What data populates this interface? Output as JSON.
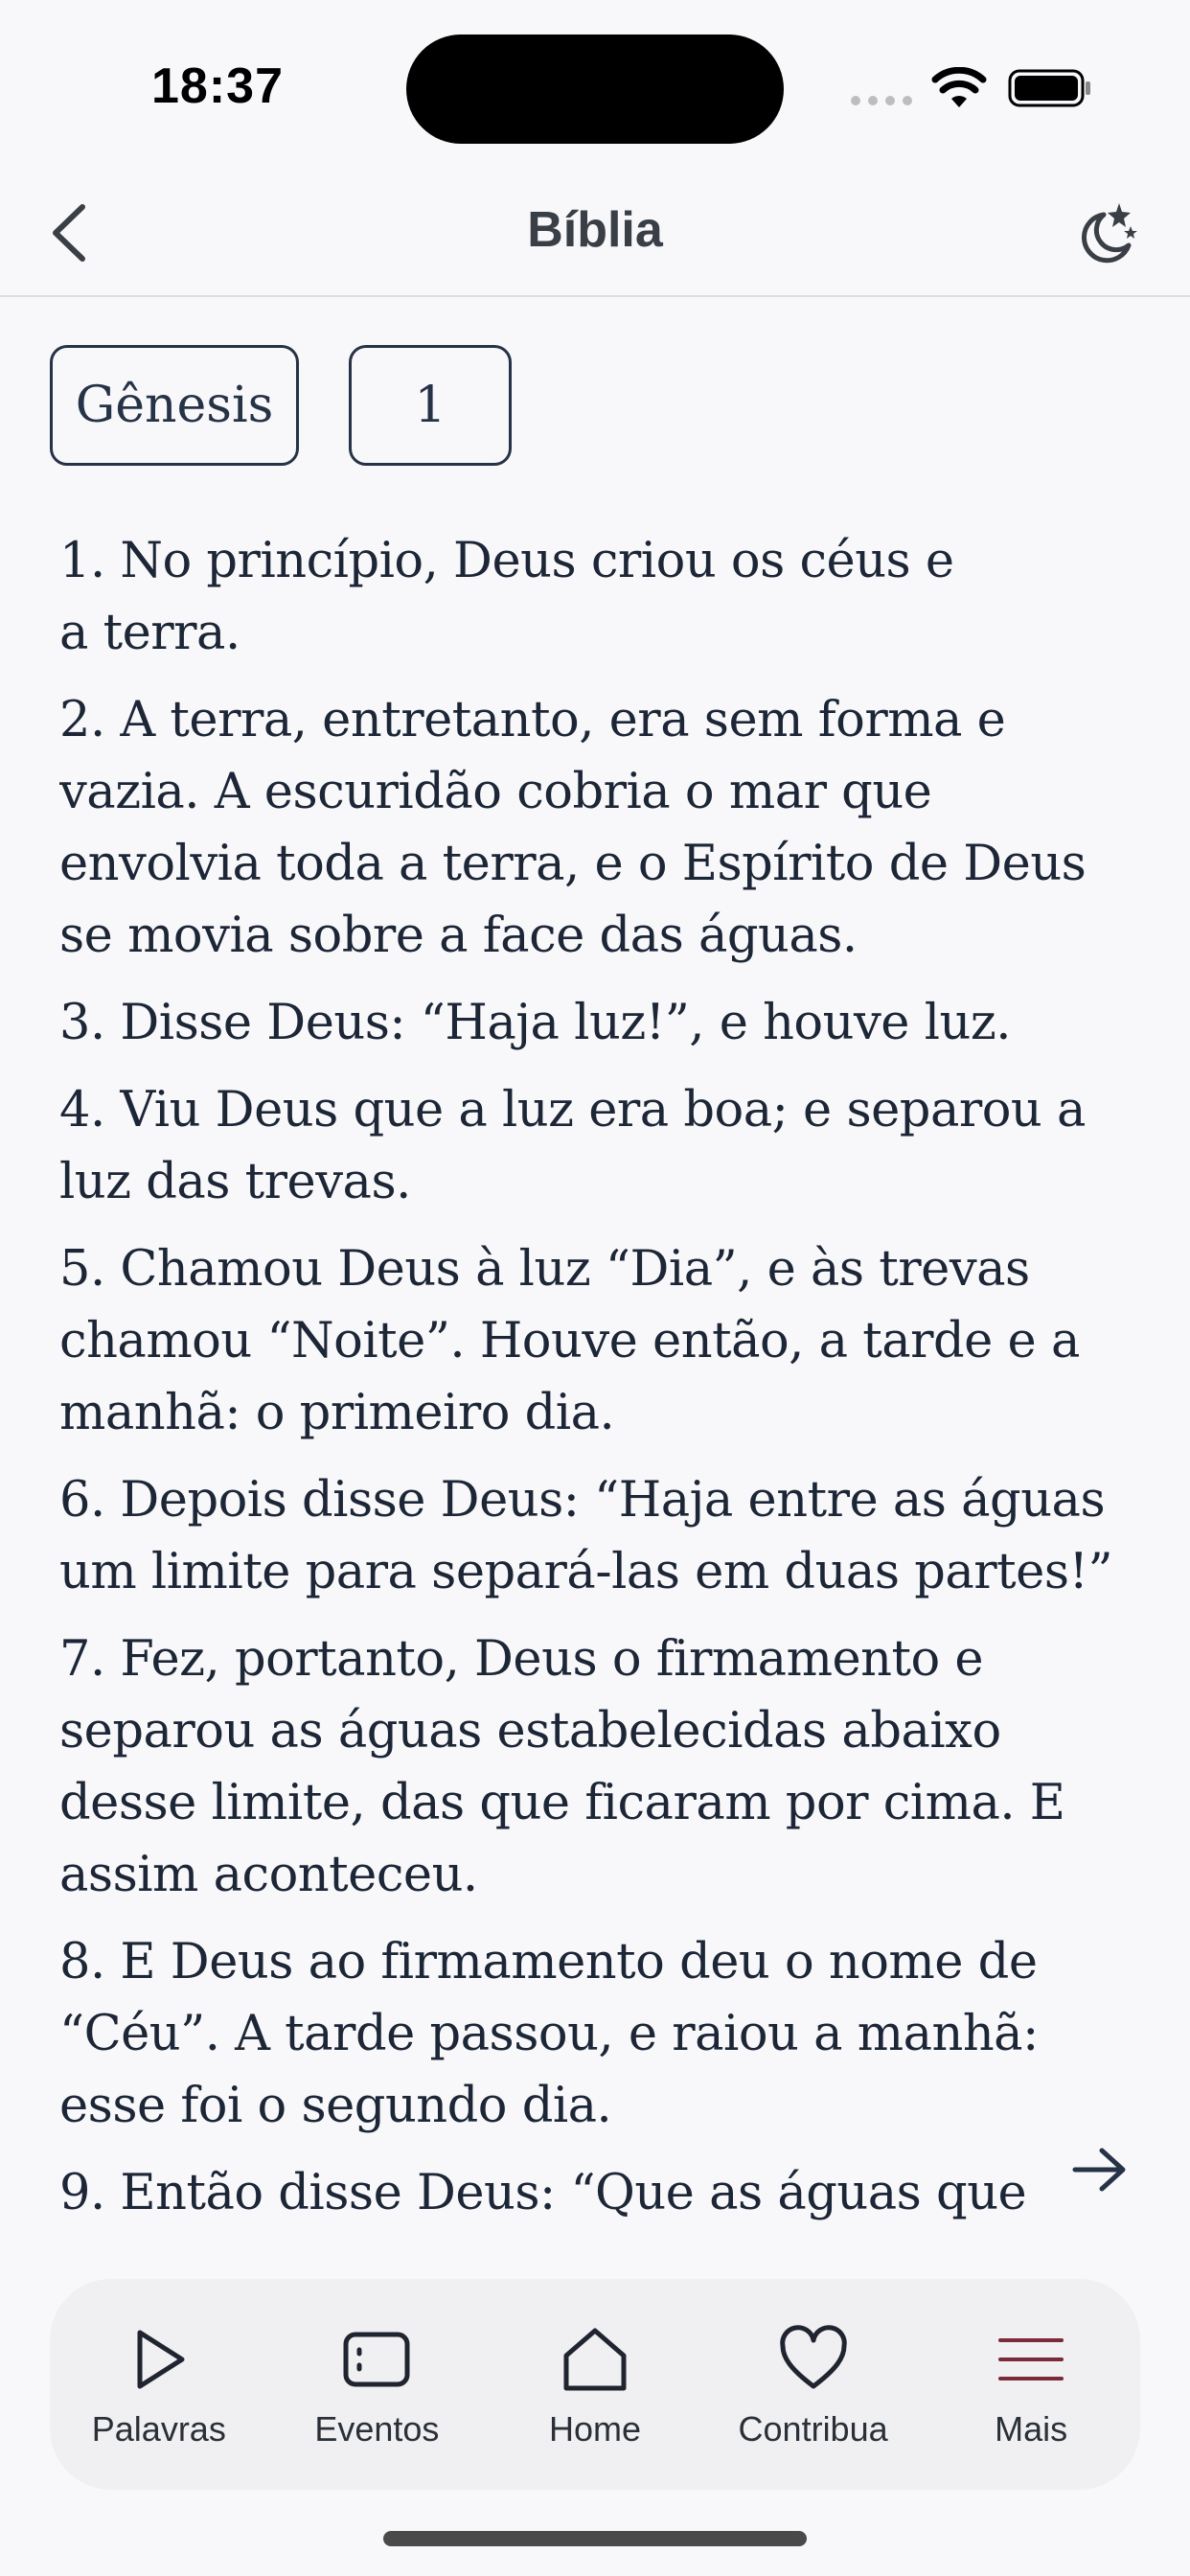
{
  "status_bar": {
    "time": "18:37"
  },
  "header": {
    "title": "Bíblia",
    "back_icon": "chevron-left-icon",
    "night_icon": "moon-stars-icon"
  },
  "selectors": {
    "book": "Gênesis",
    "chapter": "1"
  },
  "verses": [
    "1. No princípio, Deus criou os céus e\na terra.",
    "2. A terra, entretanto, era sem forma e vazia. A escuridão cobria o mar que envolvia toda a terra, e o Espírito de Deus se movia sobre a face das águas.",
    "3. Disse Deus: “Haja luz!”, e houve luz.",
    "4. Viu Deus que a luz era boa; e separou a luz das trevas.",
    "5. Chamou Deus à luz “Dia”, e às trevas chamou “Noite”. Houve então, a tarde e a manhã: o primeiro dia.",
    "6. Depois disse Deus: “Haja entre as águas um limite para separá-las em duas partes!”",
    "7. Fez, portanto, Deus o firmamento e separou as águas estabelecidas abaixo desse limite, das que ficaram por cima. E assim aconteceu.",
    "8. E Deus ao firmamento deu o nome de “Céu”. A tarde passou, e raiou a manhã: esse foi o segundo dia.",
    "9. Então disse Deus: “Que as águas que"
  ],
  "tabs": [
    {
      "label": "Palavras",
      "icon": "play-icon"
    },
    {
      "label": "Eventos",
      "icon": "calendar-card-icon"
    },
    {
      "label": "Home",
      "icon": "home-icon"
    },
    {
      "label": "Contribua",
      "icon": "heart-icon"
    },
    {
      "label": "Mais",
      "icon": "menu-lines-icon"
    }
  ],
  "colors": {
    "accent_menu": "#7a2a3a",
    "text": "#1c2636"
  }
}
